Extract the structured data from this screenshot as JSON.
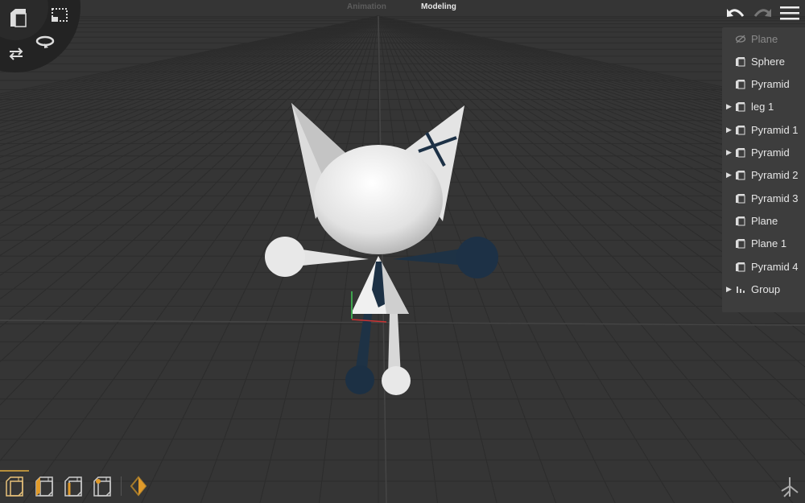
{
  "modes": {
    "animation": "Animation",
    "modeling": "Modeling",
    "active": "Modeling"
  },
  "toolbar": {
    "undo_icon": "undo-icon",
    "redo_icon": "redo-icon",
    "menu_icon": "hamburger-menu-icon"
  },
  "radial_menu": {
    "icons": [
      "cube-view-icon",
      "marquee-select-icon",
      "rotate-icon",
      "swap-icon"
    ]
  },
  "outliner": {
    "items": [
      {
        "label": "Plane",
        "hidden": true,
        "expandable": false,
        "icon": "eye-hidden-icon"
      },
      {
        "label": "Sphere",
        "expandable": false,
        "icon": "object-icon"
      },
      {
        "label": "Pyramid",
        "expandable": false,
        "icon": "object-icon"
      },
      {
        "label": "leg 1",
        "expandable": true,
        "icon": "object-icon"
      },
      {
        "label": "Pyramid 1",
        "expandable": true,
        "icon": "object-icon"
      },
      {
        "label": "Pyramid",
        "expandable": true,
        "icon": "object-icon"
      },
      {
        "label": "Pyramid 2",
        "expandable": true,
        "icon": "object-icon"
      },
      {
        "label": "Pyramid 3",
        "expandable": false,
        "icon": "object-icon"
      },
      {
        "label": "Plane",
        "expandable": false,
        "icon": "object-icon"
      },
      {
        "label": "Plane 1",
        "expandable": false,
        "icon": "object-icon"
      },
      {
        "label": "Pyramid 4",
        "expandable": false,
        "icon": "object-icon"
      },
      {
        "label": "Group",
        "expandable": true,
        "icon": "group-icon"
      }
    ]
  },
  "bottom_tools": [
    "select-object-icon",
    "select-face-icon",
    "select-edge-icon",
    "select-vertex-icon",
    "keyframe-icon"
  ],
  "colors": {
    "accent": "#e09a2a",
    "background": "#333333",
    "panel": "#3d3d3d",
    "navy": "#1f3447"
  }
}
